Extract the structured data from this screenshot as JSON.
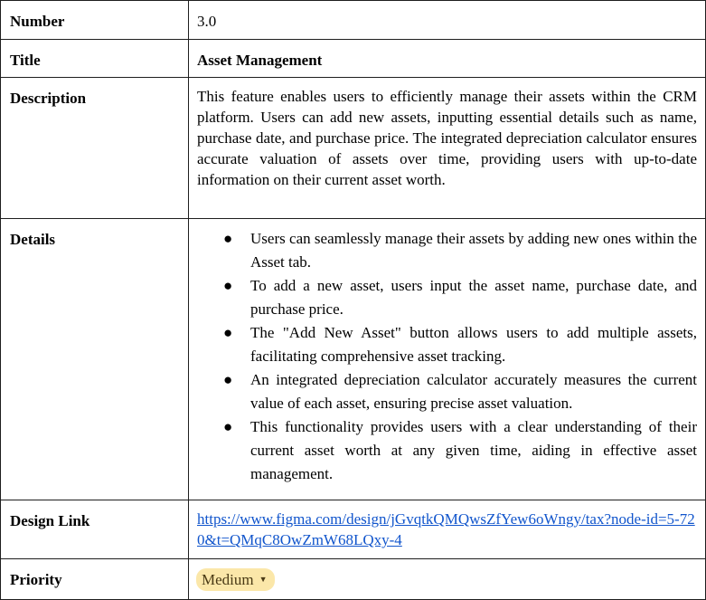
{
  "rows": {
    "number": {
      "key": "Number",
      "value": "3.0"
    },
    "title": {
      "key": "Title",
      "value": "Asset Management"
    },
    "description": {
      "key": "Description",
      "value": "This feature enables users to efficiently manage their assets within the CRM platform. Users can add new assets, inputting essential details such as name, purchase date, and purchase price. The integrated depreciation calculator ensures accurate valuation of assets over time, providing users with up-to-date information on their current asset worth."
    },
    "details": {
      "key": "Details",
      "bullet": "●",
      "items": [
        "Users can seamlessly manage their assets by adding new ones within the Asset tab.",
        "To add a new asset, users input the asset name, purchase date, and purchase price.",
        "The \"Add New Asset\" button allows users to add multiple assets, facilitating comprehensive asset tracking.",
        "An integrated depreciation calculator accurately measures the current value of each asset, ensuring precise asset valuation.",
        "This functionality provides users with a clear understanding of their current asset worth at any given time, aiding in effective asset management."
      ]
    },
    "design_link": {
      "key": "Design Link",
      "value": "https://www.figma.com/design/jGvqtkQMQwsZfYew6oWngy/tax?node-id=5-720&t=QMqC8OwZmW68LQxy-4"
    },
    "priority": {
      "key": "Priority",
      "value": "Medium",
      "chip_color": "#fbe7a9",
      "chevron_icon": "chevron-down-icon"
    }
  }
}
